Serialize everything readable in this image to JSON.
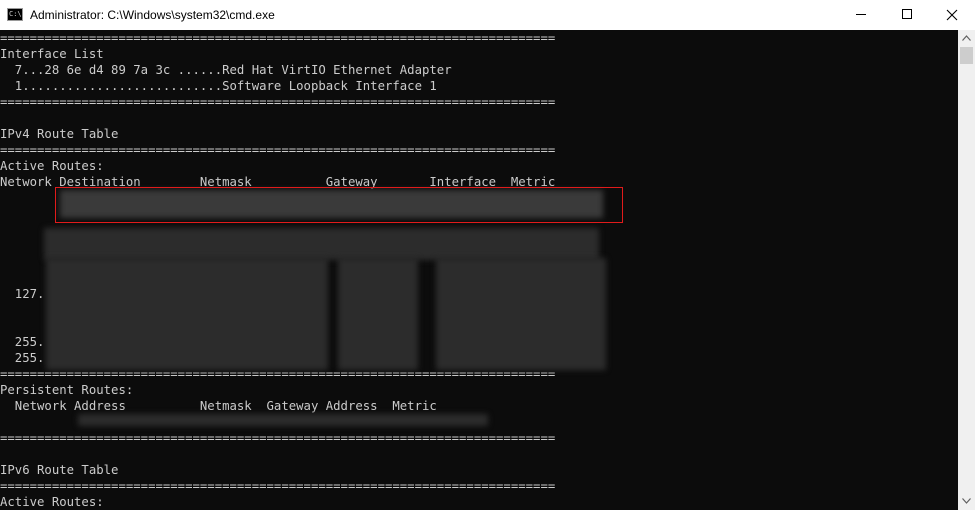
{
  "window": {
    "title": "Administrator: C:\\Windows\\system32\\cmd.exe",
    "app_icon_text": "C:\\"
  },
  "console": {
    "lines": [
      "===========================================================================",
      "Interface List",
      "  7...28 6e d4 89 7a 3c ......Red Hat VirtIO Ethernet Adapter",
      "  1...........................Software Loopback Interface 1",
      "===========================================================================",
      "",
      "IPv4 Route Table",
      "===========================================================================",
      "Active Routes:",
      "Network Destination        Netmask          Gateway       Interface  Metric",
      "",
      "",
      "",
      "",
      "",
      "  127.",
      "",
      "",
      "",
      "  255.",
      "  255.",
      "===========================================================================",
      "Persistent Routes:",
      "  Network Address          Netmask  Gateway Address  Metric",
      "",
      "",
      "===========================================================================",
      "",
      "IPv6 Route Table",
      "===========================================================================",
      "Active Routes:"
    ]
  },
  "colors": {
    "console_bg": "#0c0c0c",
    "console_fg": "#cccccc",
    "highlight_border": "#e11b1b",
    "titlebar_bg": "#ffffff"
  }
}
